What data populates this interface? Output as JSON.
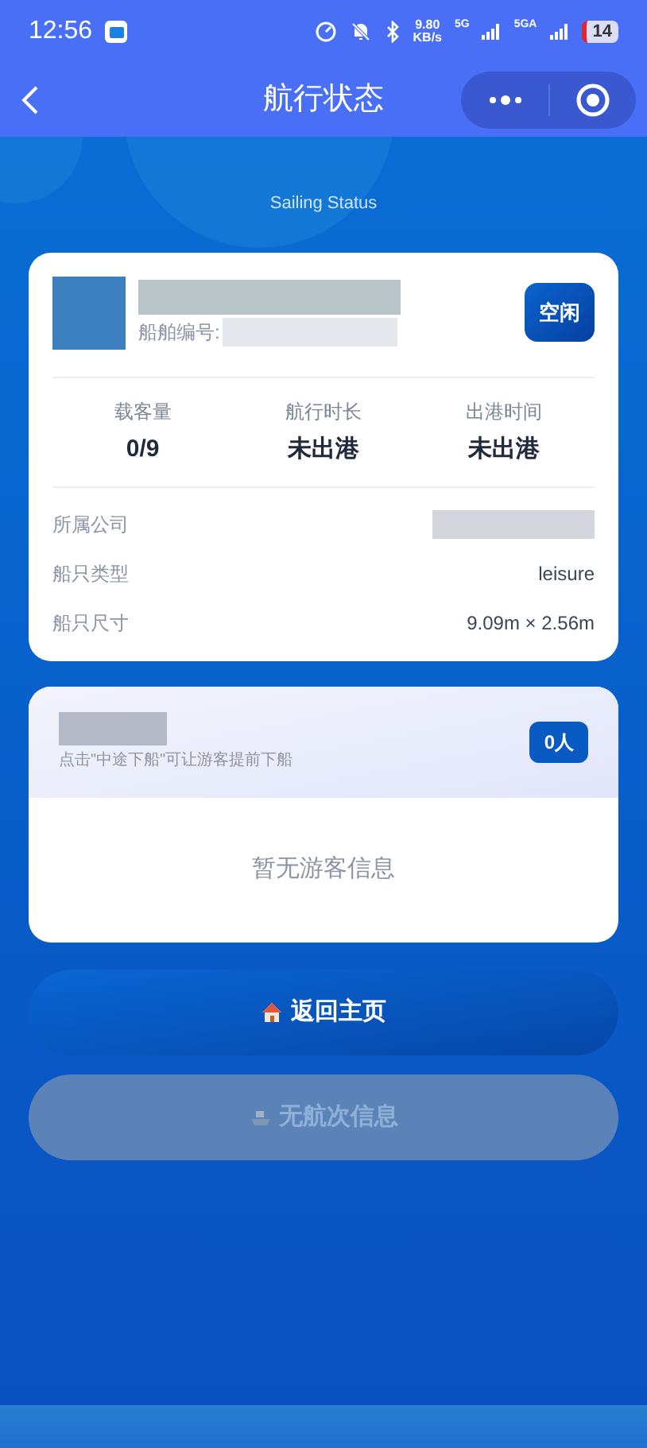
{
  "status_bar": {
    "time": "12:56",
    "net_speed": "9.80",
    "net_unit": "KB/s",
    "signal_1": "5G",
    "signal_2": "5GA",
    "battery": "14"
  },
  "nav": {
    "title": "航行状态"
  },
  "subtitle": "Sailing Status",
  "boat": {
    "id_label": "船舶编号:",
    "status": "空闲",
    "stats": [
      {
        "label": "载客量",
        "value": "0/9"
      },
      {
        "label": "航行时长",
        "value": "未出港"
      },
      {
        "label": "出港时间",
        "value": "未出港"
      }
    ],
    "details": [
      {
        "label": "所属公司",
        "redacted": true
      },
      {
        "label": "船只类型",
        "value": "leisure"
      },
      {
        "label": "船只尺寸",
        "value": "9.09m × 2.56m"
      }
    ]
  },
  "passengers": {
    "hint": "点击\"中途下船\"可让游客提前下船",
    "count": "0人",
    "empty": "暂无游客信息"
  },
  "buttons": [
    {
      "kind": "home",
      "label": "返回主页",
      "disabled": false
    },
    {
      "kind": "ship",
      "label": "无航次信息",
      "disabled": true
    }
  ]
}
